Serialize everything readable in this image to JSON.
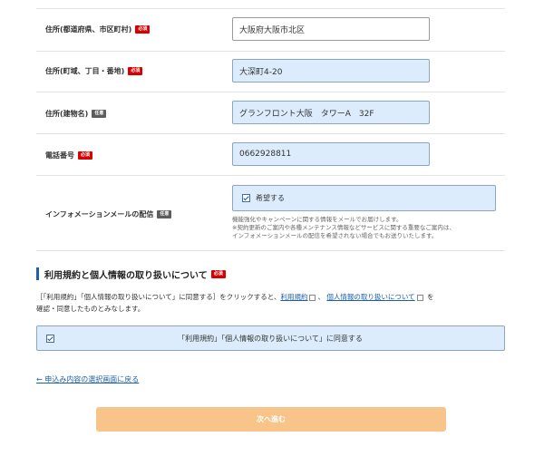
{
  "badges": {
    "required": "必須",
    "optional": "任意"
  },
  "fields": {
    "city": {
      "label": "住所(都道府県、市区町村)",
      "value": "大阪府大阪市北区"
    },
    "street": {
      "label": "住所(町域、丁目・番地)",
      "value": "大深町4-20"
    },
    "building": {
      "label": "住所(建物名)",
      "value": "グランフロント大阪　タワーA　32F"
    },
    "phone": {
      "label": "電話番号",
      "value": "0662928811"
    }
  },
  "newsletter": {
    "label": "インフォメーションメールの配信",
    "option": "希望する",
    "checked": true,
    "note_line1": "機能強化やキャンペーンに関する情報をメールでお届けします。",
    "note_line2": "※契約更新のご案内や各種メンテナンス情報などサービスに関する重要なご案内は、",
    "note_line3": "インフォメーションメールの配信を希望されない場合でもお送りいたします。"
  },
  "terms": {
    "title": "利用規約と個人情報の取り扱いについて",
    "text_before": "［「利用規約」「個人情報の取り扱いについて」に同意する］をクリックすると、",
    "link_terms": "利用規約",
    "separator": "、",
    "link_privacy": "個人情報の取り扱いについて",
    "text_after_link": "を",
    "text_line2": "確認・同意したものとみなします。",
    "agree_label": "「利用規約」「個人情報の取り扱いについて」に同意する",
    "checked": true
  },
  "nav": {
    "back": "← 申込み内容の選択画面に戻る",
    "next": "次へ進む"
  },
  "colors": {
    "accent": "#1d5fa8",
    "required": "#d80000",
    "button": "#f8c489",
    "field_filled": "#dcecfc"
  }
}
